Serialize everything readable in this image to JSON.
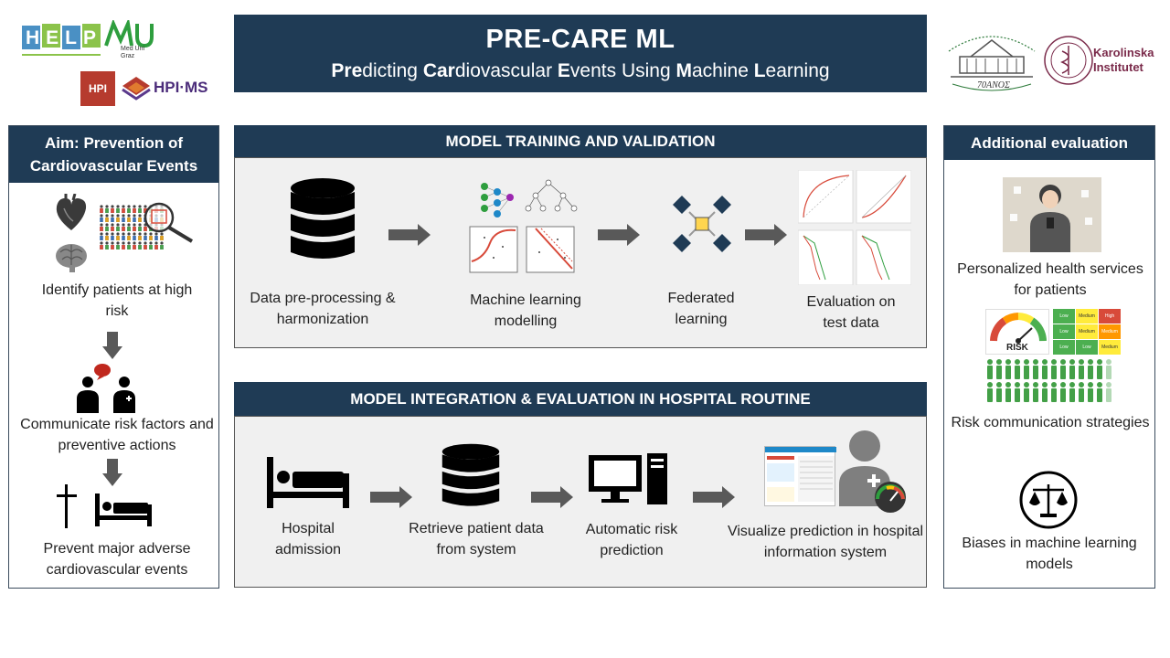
{
  "title": {
    "main": "PRE-CARE ML",
    "sub_parts": [
      {
        "b": "Pre",
        "r": "dicting "
      },
      {
        "b": "Car",
        "r": "diovascular "
      },
      {
        "b": "E",
        "r": "vents Using "
      },
      {
        "b": "M",
        "r": "achine "
      },
      {
        "b": "L",
        "r": "earning"
      }
    ]
  },
  "logos": {
    "help": "HELP",
    "meduni": "Med Uni Graz",
    "hpi": "HPI",
    "hpims": "HPI·MS",
    "athens": "70ΑΝΟΣ",
    "karolinska_1": "Karolinska",
    "karolinska_2": "Institutet"
  },
  "left": {
    "header": "Aim: Prevention of Cardiovascular  Events",
    "steps": [
      "Identify patients at high risk",
      "Communicate risk factors and preventive actions",
      "Prevent major adverse cardiovascular events"
    ]
  },
  "training": {
    "header": "MODEL TRAINING AND VALIDATION",
    "steps": [
      "Data pre-processing & harmonization",
      "Machine learning modelling",
      "Federated learning",
      "Evaluation on test data"
    ]
  },
  "integration": {
    "header": "MODEL INTEGRATION & EVALUATION IN HOSPITAL ROUTINE",
    "steps": [
      "Hospital admission",
      "Retrieve patient data from system",
      "Automatic risk prediction",
      "Visualize prediction in hospital information system"
    ]
  },
  "right": {
    "header": "Additional  evaluation",
    "items": [
      "Personalized health services for patients",
      "Risk communication strategies",
      "Biases in machine learning models"
    ],
    "risk_word": "RISK",
    "grid_labels": [
      "Low",
      "Medium",
      "High"
    ]
  },
  "colors": {
    "navy": "#1f3b55",
    "accent_green": "#43a047",
    "accent_blue": "#1e88c8"
  }
}
